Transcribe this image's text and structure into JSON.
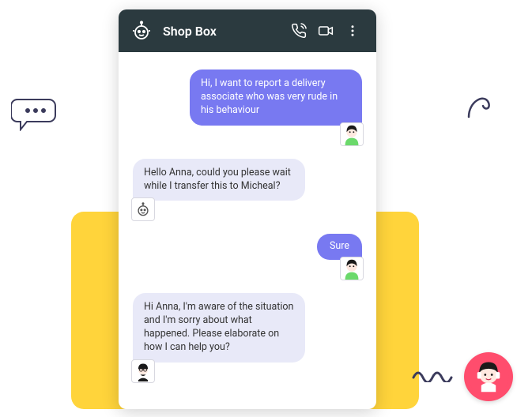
{
  "header": {
    "title": "Shop Box"
  },
  "messages": {
    "m1": "Hi, I want to report a delivery associate who was very rude in his behaviour",
    "m2": "Hello Anna, could you please wait while I transfer this to Micheal?",
    "m3": "Sure",
    "m4": "Hi Anna, I'm aware of the situation and I'm sorry about what happened. Please elaborate on how I can help you?"
  },
  "icons": {
    "bot": "bot-icon",
    "call": "call-icon",
    "video": "video-icon",
    "more": "more-icon"
  },
  "colors": {
    "header_bg": "#2b3a3f",
    "user_bubble": "#7879f1",
    "bot_bubble": "#e8e9f8",
    "accent_yellow": "#ffd43b",
    "agent_badge": "#ff4d6d"
  }
}
